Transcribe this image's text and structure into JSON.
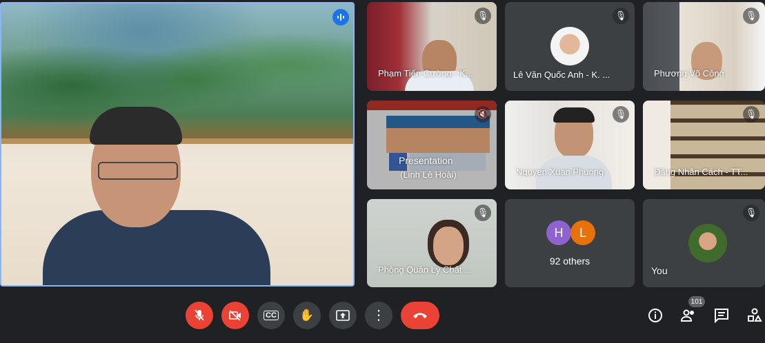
{
  "main_speaker": {
    "speaking_icon": "audio-level-icon"
  },
  "tiles": [
    {
      "name": "Phạm Tiến Cường - K...",
      "muted": true
    },
    {
      "name": "Lê Văn Quốc Anh - K. ...",
      "muted": true
    },
    {
      "name": "Phương Võ Công",
      "muted": true
    },
    {
      "name": "Presentation",
      "subname": "(Linh Lê Hoài)",
      "muted": true
    },
    {
      "name": "Nguyen Xuan Phuong",
      "muted": true
    },
    {
      "name": "Đặng Nhân Cách - TT...",
      "muted": true
    },
    {
      "name": "Phòng Quản Lý Chất ...",
      "muted": true
    },
    {
      "name": "92 others",
      "avatars": [
        "H",
        "L"
      ],
      "avatar_colors": [
        "#8e63ce",
        "#e8710a"
      ]
    },
    {
      "name": "You",
      "muted": true
    }
  ],
  "controls": {
    "mic": "mic-off-icon",
    "camera": "camera-off-icon",
    "captions_label": "CC",
    "hand": "raise-hand-icon",
    "present": "present-icon",
    "more": "more-vert-icon",
    "end": "call-end-icon"
  },
  "side_controls": {
    "participants_count": "101",
    "info": "info-icon",
    "people": "people-icon",
    "chat": "chat-icon",
    "activities": "activities-icon"
  },
  "colors": {
    "accent": "#8ab4f8",
    "danger": "#ea4335",
    "speaking": "#1a73e8"
  }
}
